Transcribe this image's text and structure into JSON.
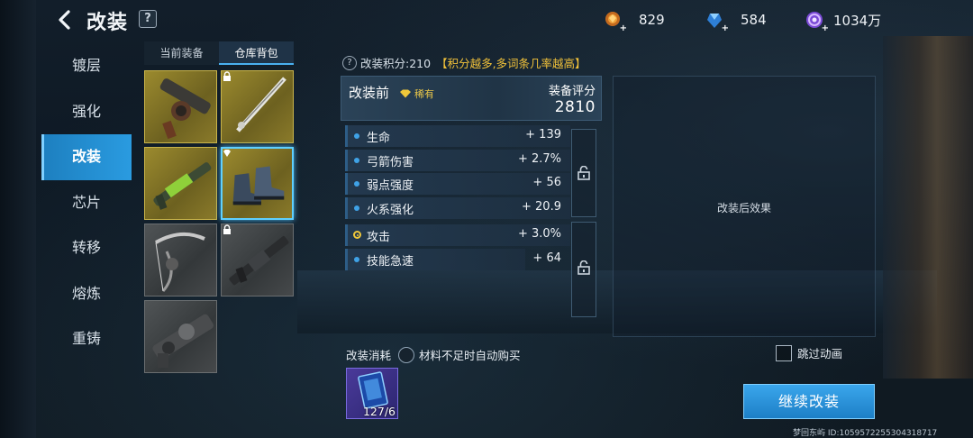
{
  "header": {
    "title": "改装",
    "help": "?",
    "resources": [
      {
        "icon": "gold-ore-icon",
        "value": "829"
      },
      {
        "icon": "blue-crystal-icon",
        "value": "584"
      },
      {
        "icon": "purple-coin-icon",
        "value": "1034万"
      }
    ]
  },
  "sidebar": {
    "items": [
      {
        "label": "镀层",
        "active": false
      },
      {
        "label": "强化",
        "active": false
      },
      {
        "label": "改装",
        "active": true
      },
      {
        "label": "芯片",
        "active": false
      },
      {
        "label": "转移",
        "active": false
      },
      {
        "label": "熔炼",
        "active": false
      },
      {
        "label": "重铸",
        "active": false
      }
    ]
  },
  "inventory": {
    "tabs": [
      "当前装备",
      "仓库背包"
    ],
    "active_tab": 1,
    "slots": [
      {
        "item": "grenade-launcher",
        "rarity": "gold",
        "locked": false,
        "gem": false,
        "selected": false
      },
      {
        "item": "silver-sword",
        "rarity": "gold",
        "locked": true,
        "gem": false,
        "selected": false
      },
      {
        "item": "green-rifle",
        "rarity": "gold",
        "locked": false,
        "gem": false,
        "selected": false
      },
      {
        "item": "boots",
        "rarity": "gold",
        "locked": false,
        "gem": true,
        "selected": true
      },
      {
        "item": "bow",
        "rarity": "gray",
        "locked": false,
        "gem": false,
        "selected": false
      },
      {
        "item": "assault-rifle",
        "rarity": "gray",
        "locked": true,
        "gem": false,
        "selected": false
      },
      {
        "item": "heavy-gun",
        "rarity": "gray",
        "locked": false,
        "gem": false,
        "selected": false
      }
    ]
  },
  "score_line": {
    "label": "改装积分:210",
    "hint": "【积分越多,多词条几率越高】"
  },
  "before": {
    "title": "改装前",
    "rarity": "稀有",
    "score_label": "装备评分",
    "score": "2810",
    "group1": [
      {
        "name": "生命",
        "value": "+ 139"
      },
      {
        "name": "弓箭伤害",
        "value": "+ 2.7%"
      },
      {
        "name": "弱点强度",
        "value": "+ 56"
      },
      {
        "name": "火系强化",
        "value": "+ 20.9"
      }
    ],
    "group2": [
      {
        "name": "攻击",
        "value": "+ 3.0%",
        "special": true
      },
      {
        "name": "技能急速",
        "value": "+ 64",
        "special": false
      }
    ]
  },
  "after": {
    "label": "改装后效果"
  },
  "cost": {
    "label": "改装消耗",
    "auto_buy": "材料不足时自动购买",
    "material_count": "127/6"
  },
  "skip_label": "跳过动画",
  "continue_label": "继续改装",
  "footer": "梦回东屿  ID:1059572255304318717",
  "colors": {
    "accent": "#2a9be0",
    "gold": "#f2c23a",
    "rarity_gold": "#9b8a2e"
  }
}
